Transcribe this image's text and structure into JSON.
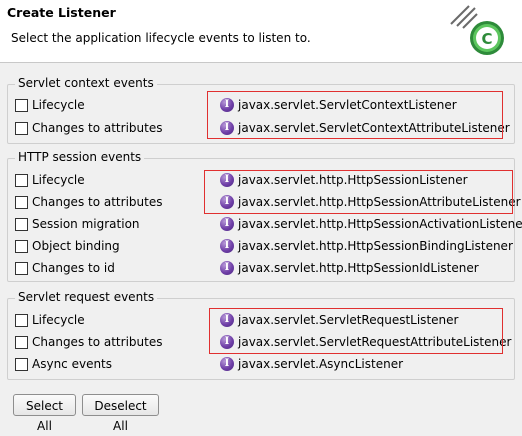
{
  "header": {
    "title": "Create Listener",
    "description": "Select the application lifecycle events to listen to."
  },
  "groups": [
    {
      "title": "Servlet context events",
      "items": [
        {
          "label": "Lifecycle",
          "class_name": "javax.servlet.ServletContextListener",
          "checked": false
        },
        {
          "label": "Changes to attributes",
          "class_name": "javax.servlet.ServletContextAttributeListener",
          "checked": false
        }
      ]
    },
    {
      "title": "HTTP session events",
      "items": [
        {
          "label": "Lifecycle",
          "class_name": "javax.servlet.http.HttpSessionListener",
          "checked": false
        },
        {
          "label": "Changes to attributes",
          "class_name": "javax.servlet.http.HttpSessionAttributeListener",
          "checked": false
        },
        {
          "label": "Session migration",
          "class_name": "javax.servlet.http.HttpSessionActivationListener",
          "checked": false
        },
        {
          "label": "Object binding",
          "class_name": "javax.servlet.http.HttpSessionBindingListener",
          "checked": false
        },
        {
          "label": "Changes to id",
          "class_name": "javax.servlet.http.HttpSessionIdListener",
          "checked": false
        }
      ]
    },
    {
      "title": "Servlet request events",
      "items": [
        {
          "label": "Lifecycle",
          "class_name": "javax.servlet.ServletRequestListener",
          "checked": false
        },
        {
          "label": "Changes to attributes",
          "class_name": "javax.servlet.ServletRequestAttributeListener",
          "checked": false
        },
        {
          "label": "Async events",
          "class_name": "javax.servlet.AsyncListener",
          "checked": false
        }
      ]
    }
  ],
  "buttons": {
    "select_all": "Select All",
    "deselect_all": "Deselect All"
  },
  "icons": {
    "interface": "interface-icon",
    "wizard": "wizard-banner-icon"
  },
  "colors": {
    "highlight": "#e03030",
    "interface_icon": "#7040a8",
    "wizard_accent": "#4caf50"
  }
}
